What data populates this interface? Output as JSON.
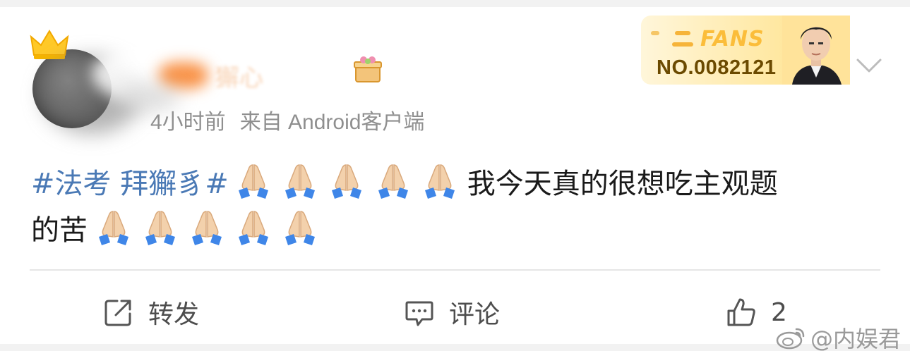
{
  "post": {
    "meta_time": "4小时前",
    "meta_source": "来自 Android客户端",
    "topic": "#法考 拜獬豸#",
    "text_line1": "我今天真的很想吃主观题",
    "text_line2": "的苦",
    "emoji_count_line1": 5,
    "emoji_count_line2": 5
  },
  "fans_badge": {
    "word": "FANS",
    "number": "NO.0082121"
  },
  "actions": {
    "repost_label": "转发",
    "comment_label": "评论",
    "like_count": "2"
  },
  "watermark": {
    "text": "@内娱君"
  },
  "colors": {
    "topic": "#4a79b5",
    "fans_gold": "#fbbd3a",
    "fans_number": "#6b4a00",
    "text": "#1a1a1a",
    "meta": "#8f8f8f"
  },
  "icons": {
    "crown": "crown-icon",
    "gift": "gift-badge-icon",
    "chevron": "chevron-down-icon",
    "repost": "share-icon",
    "comment": "comment-icon",
    "like": "thumbs-up-icon",
    "emoji": "folded-hands-emoji",
    "weibo": "weibo-logo-icon"
  }
}
